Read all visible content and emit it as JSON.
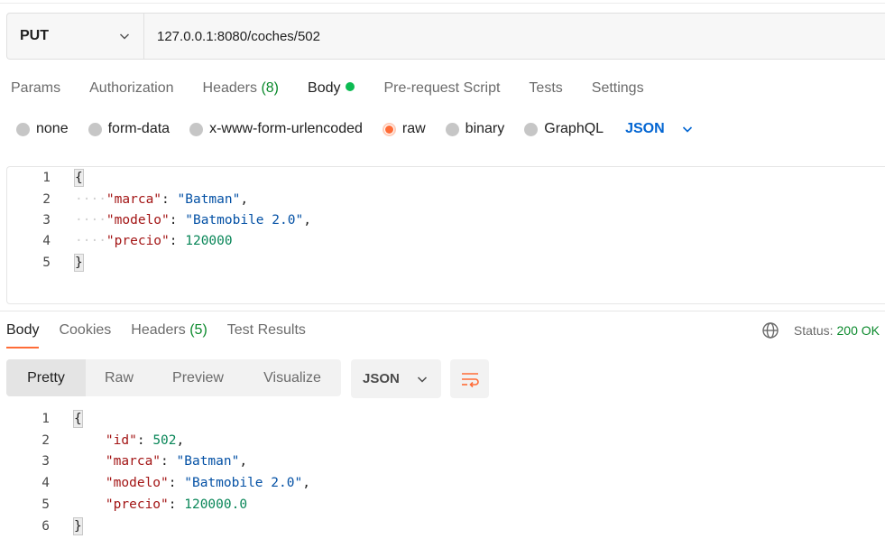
{
  "request": {
    "method": "PUT",
    "url": "127.0.0.1:8080/coches/502"
  },
  "request_tabs": [
    {
      "label": "Params"
    },
    {
      "label": "Authorization"
    },
    {
      "label": "Headers",
      "count": "(8)"
    },
    {
      "label": "Body",
      "active": true,
      "indicator": "green-dot"
    },
    {
      "label": "Pre-request Script"
    },
    {
      "label": "Tests"
    },
    {
      "label": "Settings"
    }
  ],
  "body_types": [
    {
      "label": "none",
      "selected": false
    },
    {
      "label": "form-data",
      "selected": false
    },
    {
      "label": "x-www-form-urlencoded",
      "selected": false
    },
    {
      "label": "raw",
      "selected": true
    },
    {
      "label": "binary",
      "selected": false
    },
    {
      "label": "GraphQL",
      "selected": false
    }
  ],
  "raw_language": "JSON",
  "request_body": {
    "line_numbers": [
      "1",
      "2",
      "3",
      "4",
      "5"
    ],
    "open": "{",
    "close": "}",
    "fields": [
      {
        "key": "\"marca\"",
        "sep": ": ",
        "value": "\"Batman\"",
        "type": "string",
        "comma": ","
      },
      {
        "key": "\"modelo\"",
        "sep": ": ",
        "value": "\"Batmobile 2.0\"",
        "type": "string",
        "comma": ","
      },
      {
        "key": "\"precio\"",
        "sep": ": ",
        "value": "120000",
        "type": "number",
        "comma": ""
      }
    ]
  },
  "response_tabs": [
    {
      "label": "Body",
      "active": true
    },
    {
      "label": "Cookies"
    },
    {
      "label": "Headers",
      "count": "(5)"
    },
    {
      "label": "Test Results"
    }
  ],
  "status": {
    "label": "Status:",
    "value": "200 OK"
  },
  "response_views": [
    "Pretty",
    "Raw",
    "Preview",
    "Visualize"
  ],
  "response_format": "JSON",
  "response_body": {
    "line_numbers": [
      "1",
      "2",
      "3",
      "4",
      "5",
      "6"
    ],
    "open": "{",
    "close": "}",
    "fields": [
      {
        "key": "\"id\"",
        "sep": ": ",
        "value": "502",
        "type": "number",
        "comma": ","
      },
      {
        "key": "\"marca\"",
        "sep": ": ",
        "value": "\"Batman\"",
        "type": "string",
        "comma": ","
      },
      {
        "key": "\"modelo\"",
        "sep": ": ",
        "value": "\"Batmobile 2.0\"",
        "type": "string",
        "comma": ","
      },
      {
        "key": "\"precio\"",
        "sep": ": ",
        "value": "120000.0",
        "type": "number",
        "comma": ""
      }
    ]
  },
  "colors": {
    "accent": "#ff6c37",
    "success": "#0c8a2d",
    "json_key": "#a31515",
    "json_string": "#0451a5",
    "json_number": "#098658",
    "link_blue": "#0265d2"
  },
  "icons": {
    "method_dropdown": "chevron-down-icon",
    "language_dropdown": "chevron-down-icon",
    "network": "globe-icon",
    "wrap": "wrap-lines-icon"
  }
}
